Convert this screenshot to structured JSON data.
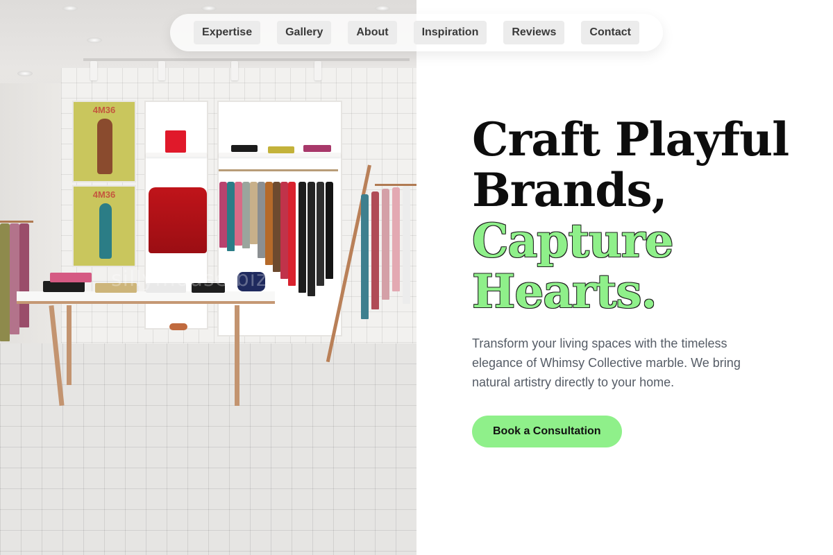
{
  "nav": {
    "items": [
      {
        "label": "Expertise"
      },
      {
        "label": "Gallery"
      },
      {
        "label": "About"
      },
      {
        "label": "Inspiration"
      },
      {
        "label": "Reviews"
      },
      {
        "label": "Contact"
      }
    ]
  },
  "hero": {
    "headline_line1": "Craft Playful",
    "headline_line2": "Brands,",
    "headline_line3": "Capture",
    "headline_line4": "Hearts.",
    "subtitle": "Transform your living spaces with the timeless elegance of Whimsy Collective marble. We bring natural artistry directly to your home.",
    "cta_label": "Book a Consultation"
  },
  "photo": {
    "poster_text_top": "4M36",
    "poster_text_bottom": "4M36",
    "watermark": "sillymouse.biz"
  },
  "colors": {
    "accent": "#8ff08a",
    "headline": "#0d0d0d",
    "subtitle": "#555c66"
  }
}
